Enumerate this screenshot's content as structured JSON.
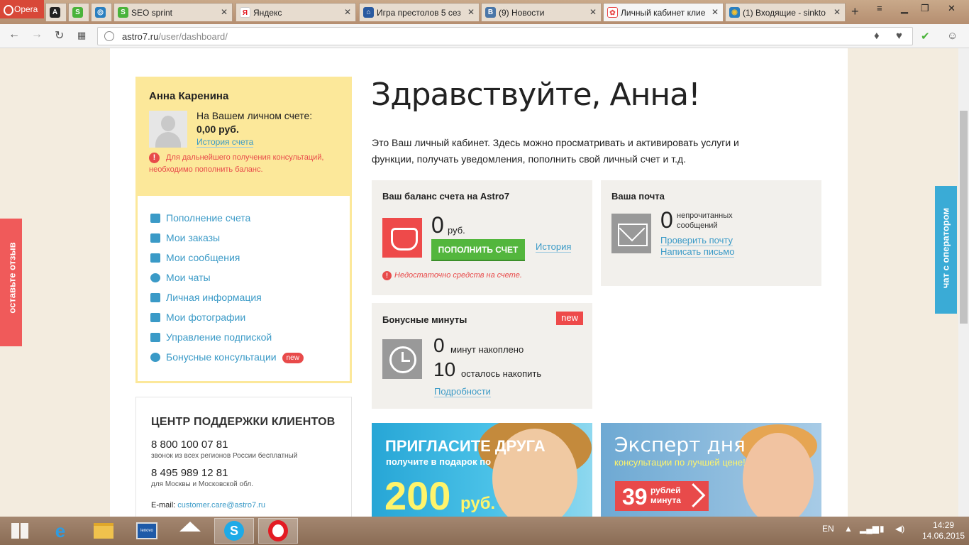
{
  "browser": {
    "opera_label": "Opera",
    "tabs": [
      {
        "label": "",
        "icon": "A"
      },
      {
        "label": "",
        "icon": "S"
      },
      {
        "label": "",
        "icon": "◎"
      },
      {
        "label": "SEO sprint",
        "icon": "S"
      },
      {
        "label": "Яндекс",
        "icon": "Я"
      },
      {
        "label": "Игра престолов 5 сез",
        "icon": "⌂"
      },
      {
        "label": "(9) Новости",
        "icon": "B"
      },
      {
        "label": "Личный кабинет клие",
        "icon": "✿"
      },
      {
        "label": "(1) Входящие - sinkto",
        "icon": "◉"
      }
    ],
    "close_glyph": "✕",
    "new_tab_glyph": "+",
    "url_domain": "astro7.ru",
    "url_path": "/user/dashboard/"
  },
  "profile": {
    "name": "Анна Каренина",
    "balance_label": "На Вашем личном счете:",
    "balance_value": "0,00 руб.",
    "history_link": "История счета",
    "warning": "Для дальнейшего получения консультаций, необходимо пополнить баланс.",
    "warning_glyph": "!",
    "menu": [
      {
        "label": "Пополнение счета",
        "icon": "wallet-icon"
      },
      {
        "label": "Мои заказы",
        "icon": "cart-icon"
      },
      {
        "label": "Мои сообщения",
        "icon": "envelope-icon"
      },
      {
        "label": "Мои чаты",
        "icon": "chat-bubble-icon"
      },
      {
        "label": "Личная информация",
        "icon": "id-card-icon"
      },
      {
        "label": "Мои фотографии",
        "icon": "camera-icon"
      },
      {
        "label": "Управление подпиской",
        "icon": "calendar-icon"
      },
      {
        "label": "Бонусные консультации",
        "icon": "clock-icon",
        "badge": "new"
      }
    ]
  },
  "support": {
    "title": "ЦЕНТР ПОДДЕРЖКИ КЛИЕНТОВ",
    "phone1": "8 800 100 07 81",
    "phone1_note": "звонок из всех регионов России бесплатный",
    "phone2": "8 495 989 12 81",
    "phone2_note": "для Москвы и Московской обл.",
    "email_label": "E-mail:",
    "email": "customer.care@astro7.ru"
  },
  "main": {
    "greeting": "Здравствуйте, Анна!",
    "intro": "Это Ваш личный кабинет. Здесь можно просматривать и активировать услуги и функции, получать уведомления, пополнить свой личный счет и т.д.",
    "balance_card": {
      "title": "Ваш баланс счета на Astro7",
      "amount": "0",
      "unit": "руб.",
      "topup_button": "ПОПОЛНИТЬ СЧЕТ",
      "history_link": "История",
      "warning": "Недостаточно средств на счете."
    },
    "mail_card": {
      "title": "Ваша почта",
      "count": "0",
      "count_label": "непрочитанных сообщений",
      "check_link": "Проверить почту",
      "write_link": "Написать письмо"
    },
    "bonus_card": {
      "title": "Бонусные минуты",
      "badge": "new",
      "accumulated": "0",
      "accumulated_label": "минут накоплено",
      "remaining": "10",
      "remaining_label": "осталось накопить",
      "details_link": "Подробности"
    },
    "banner_invite": {
      "title": "ПРИГЛАСИТЕ ДРУГА",
      "subtitle": "получите в подарок по",
      "amount": "200",
      "unit": "руб."
    },
    "banner_expert": {
      "title": "Эксперт дня",
      "subtitle": "консультации по лучшей цене!",
      "price": "39",
      "price_label": "рублей минута"
    }
  },
  "side_tabs": {
    "feedback": "оставьте отзыв",
    "chat": "чат с оператором"
  },
  "taskbar": {
    "lang": "EN",
    "time": "14:29",
    "date": "14.06.2015"
  },
  "colors": {
    "accent_link": "#3a9ac7",
    "warning_red": "#e84a4a",
    "topup_green": "#53b63d",
    "profile_yellow": "#fce89a"
  }
}
